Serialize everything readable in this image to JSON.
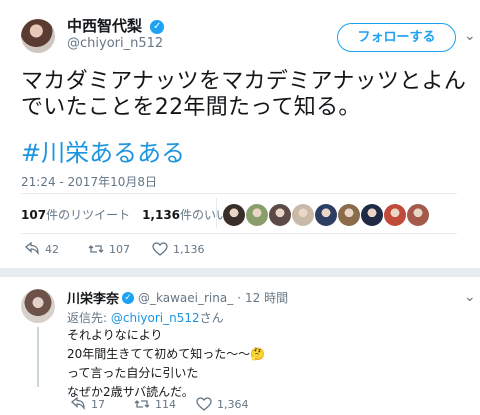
{
  "header": {
    "display_name": "中西智代梨",
    "handle": "@chiyori_n512",
    "follow_label": "フォローする"
  },
  "tweet": {
    "line1": "マカダミアナッツをマカデミアナッツとよん",
    "line2": "でいたことを22年間たって知る。",
    "hashtag": "#川栄あるある",
    "timestamp": "21:24 - 2017年10月8日",
    "retweets_count": "107",
    "retweets_label": "件のリツイート",
    "likes_count": "1,136",
    "likes_label": "件のいいね",
    "actions": {
      "replies": "42",
      "retweets": "107",
      "likes": "1,136"
    }
  },
  "liker_avatar_colors": [
    "#3a2f28",
    "#8a9e6c",
    "#5b4a45",
    "#c9b9a8",
    "#2c3f63",
    "#8a6b4a",
    "#1f2a44",
    "#c24a3a",
    "#a45a4a"
  ],
  "reply": {
    "display_name": "川栄李奈",
    "handle": "@_kawaei_rina_",
    "time": "12 時間",
    "replying_prefix": "返信先: ",
    "replying_to": "@chiyori_n512",
    "replying_suffix": "さん",
    "lines": [
      "それよりなにより",
      "20年間生きてて初めて知った〜〜🤔",
      "って言った自分に引いた",
      "なぜか2歳サバ読んだ。"
    ],
    "actions": {
      "replies": "17",
      "retweets": "114",
      "likes": "1,364"
    }
  },
  "colors": {
    "accent": "#1da1f2",
    "muted": "#657786",
    "like": "#e0245e",
    "retweet": "#17bf63"
  }
}
